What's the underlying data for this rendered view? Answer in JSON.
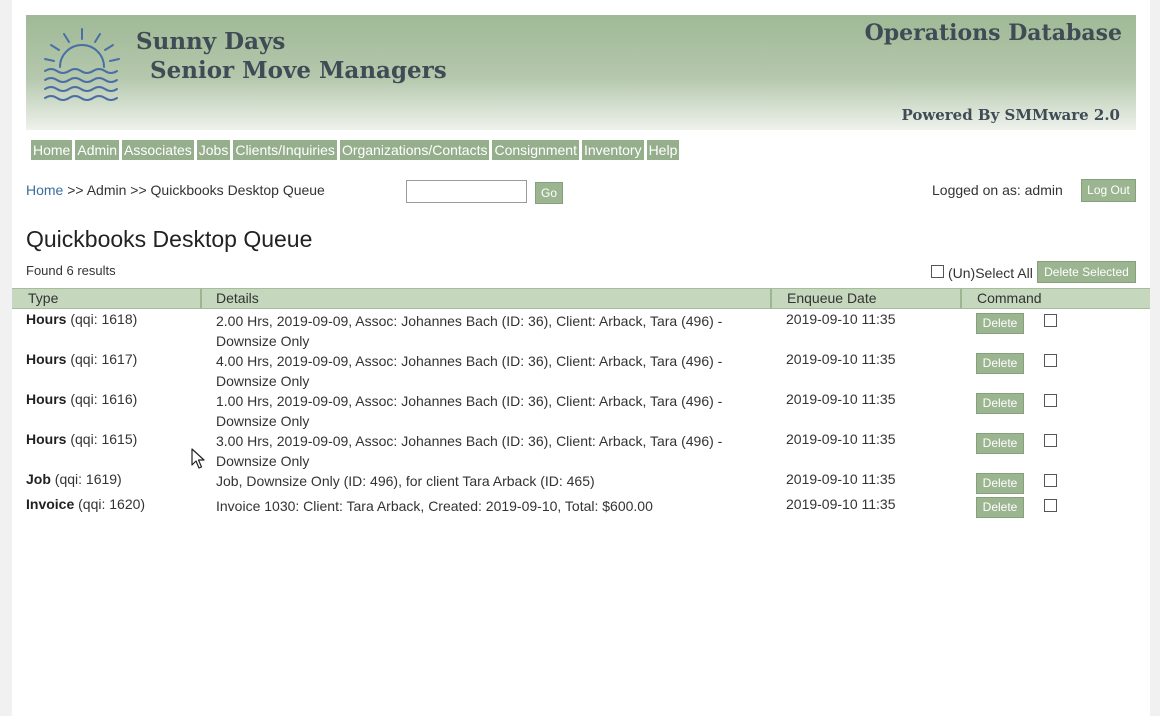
{
  "header": {
    "brand_line1": "Sunny Days",
    "brand_line2": "Senior Move Managers",
    "app_title": "Operations Database",
    "powered_by": "Powered By SMMware 2.0"
  },
  "nav": [
    {
      "label": "Home"
    },
    {
      "label": "Admin"
    },
    {
      "label": "Associates"
    },
    {
      "label": "Jobs"
    },
    {
      "label": "Clients/Inquiries"
    },
    {
      "label": "Organizations/Contacts"
    },
    {
      "label": "Consignment"
    },
    {
      "label": "Inventory"
    },
    {
      "label": "Help"
    }
  ],
  "breadcrumb": {
    "home": "Home",
    "rest": " >> Admin >> Quickbooks Desktop Queue"
  },
  "search": {
    "value": "",
    "go_label": "Go"
  },
  "session": {
    "logged_on": "Logged on as: admin",
    "logout_label": "Log Out"
  },
  "page": {
    "title": "Quickbooks Desktop Queue",
    "found": "Found 6 results",
    "select_all_label": "(Un)Select All",
    "delete_selected_label": "Delete Selected"
  },
  "table": {
    "headers": [
      "Type",
      "Details",
      "Enqueue Date",
      "Command"
    ],
    "delete_label": "Delete",
    "rows": [
      {
        "type": "Hours",
        "qqi": "(qqi: 1618)",
        "details": "2.00 Hrs, 2019-09-09, Assoc: Johannes Bach (ID: 36), Client: Arback, Tara (496) - Downsize Only",
        "date": "2019-09-10 11:35"
      },
      {
        "type": "Hours",
        "qqi": "(qqi: 1617)",
        "details": "4.00 Hrs, 2019-09-09, Assoc: Johannes Bach (ID: 36), Client: Arback, Tara (496) - Downsize Only",
        "date": "2019-09-10 11:35"
      },
      {
        "type": "Hours",
        "qqi": "(qqi: 1616)",
        "details": "1.00 Hrs, 2019-09-09, Assoc: Johannes Bach (ID: 36), Client: Arback, Tara (496) - Downsize Only",
        "date": "2019-09-10 11:35"
      },
      {
        "type": "Hours",
        "qqi": "(qqi: 1615)",
        "details": "3.00 Hrs, 2019-09-09, Assoc: Johannes Bach (ID: 36), Client: Arback, Tara (496) - Downsize Only",
        "date": "2019-09-10 11:35"
      },
      {
        "type": "Job",
        "qqi": "(qqi: 1619)",
        "details": "Job, Downsize Only (ID: 496), for client Tara Arback (ID: 465)",
        "date": "2019-09-10 11:35"
      },
      {
        "type": "Invoice",
        "qqi": "(qqi: 1620)",
        "details": "Invoice 1030: Client: Tara Arback, Created: 2019-09-10, Total: $600.00",
        "date": "2019-09-10 11:35"
      }
    ]
  },
  "colors": {
    "header_green": "#9fb996",
    "nav_button": "#95ae8b",
    "table_header": "#c5d7bd",
    "link_blue": "#3a6d9e"
  }
}
